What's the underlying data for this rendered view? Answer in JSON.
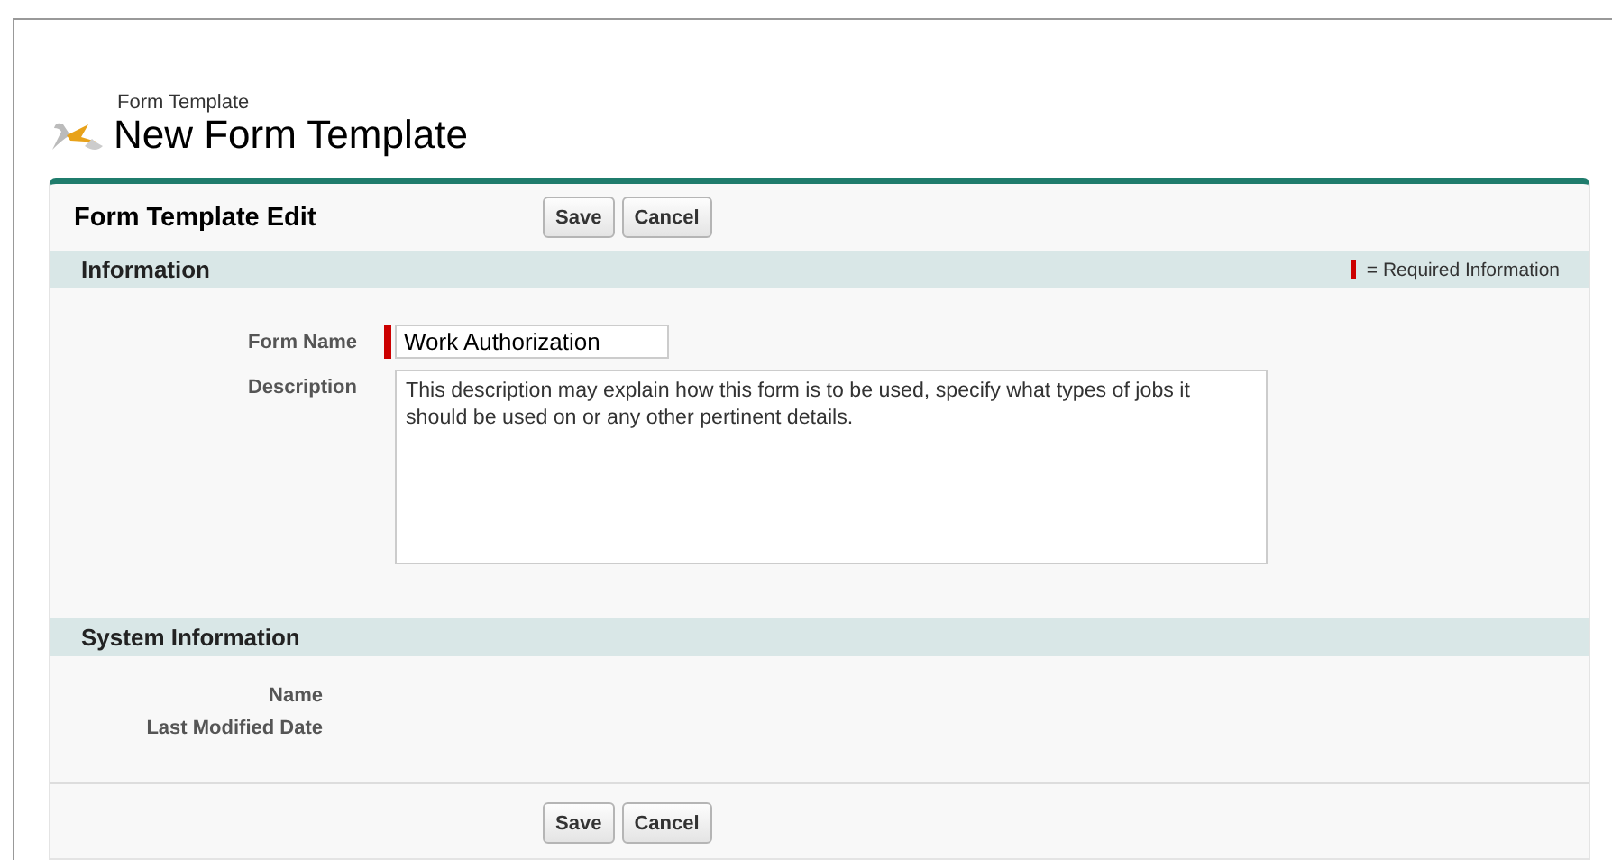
{
  "header": {
    "breadcrumb": "Form Template",
    "title": "New Form Template"
  },
  "panel": {
    "title": "Form Template Edit",
    "top_buttons": [
      "Save",
      "Cancel"
    ],
    "bottom_buttons": [
      "Save",
      "Cancel"
    ]
  },
  "sections": [
    {
      "title": "Information",
      "legend": "= Required Information",
      "fields": [
        {
          "label": "Form Name",
          "kind": "input",
          "required": true,
          "value": "Work Authorization"
        },
        {
          "label": "Description",
          "kind": "textarea",
          "required": false,
          "value": "This description may explain how this form is to be used, specify what types of jobs it should be used on or any other pertinent details."
        }
      ]
    },
    {
      "title": "System Information",
      "fields": [
        {
          "label": "Name",
          "kind": "readonly"
        },
        {
          "label": "Last Modified Date",
          "kind": "readonly"
        }
      ]
    }
  ]
}
